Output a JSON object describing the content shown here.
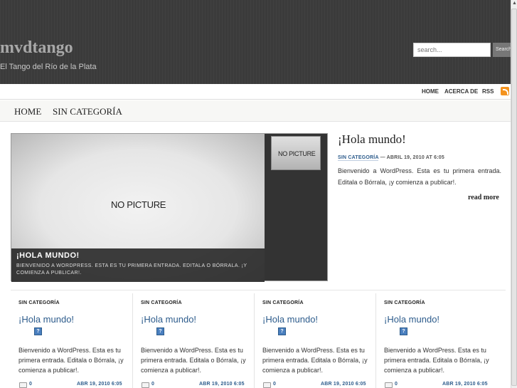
{
  "site": {
    "title": "mvdtango",
    "tagline": "El Tango del Río de la Plata"
  },
  "search": {
    "placeholder": "search...",
    "button_label": "Search"
  },
  "top_links": [
    "HOME",
    "ACERCA DE",
    "RSS"
  ],
  "category_nav": [
    "HOME",
    "SIN CATEGORÍA"
  ],
  "slider": {
    "image_text": "NO PICTURE",
    "caption_title": "¡HOLA MUNDO!",
    "caption_text": "BIENVENIDO A WORDPRESS. ESTA ES TU PRIMERA ENTRADA. EDITALA O BÓRRALA. ¡Y COMIENZA A PUBLICAR!.",
    "thumb_text": "NO PICTURE"
  },
  "featured": {
    "title": "¡Hola mundo!",
    "category": "SIN CATEGORÍA",
    "meta": " — ABRIL 19, 2010 AT 6:05",
    "excerpt": "Bienvenido a WordPress. Esta es tu primera entrada. Editala o Bórrala, ¡y comienza a publicar!.",
    "read_more": "read more"
  },
  "posts": [
    {
      "category": "SIN CATEGORÍA",
      "title": "¡Hola mundo!",
      "image_icon": "?",
      "excerpt": "Bienvenido a WordPress. Esta es tu primera entrada. Editala o Bórrala, ¡y comienza a publicar!.",
      "comments": "0",
      "date": "ABR 19, 2010 6:05"
    },
    {
      "category": "SIN CATEGORÍA",
      "title": "¡Hola mundo!",
      "image_icon": "?",
      "excerpt": "Bienvenido a WordPress. Esta es tu primera entrada. Editala o Bórrala, ¡y comienza a publicar!.",
      "comments": "0",
      "date": "ABR 19, 2010 6:05"
    },
    {
      "category": "SIN CATEGORÍA",
      "title": "¡Hola mundo!",
      "image_icon": "?",
      "excerpt": "Bienvenido a WordPress. Esta es tu primera entrada. Editala o Bórrala, ¡y comienza a publicar!.",
      "comments": "0",
      "date": "ABR 19, 2010 6:05"
    },
    {
      "category": "SIN CATEGORÍA",
      "title": "¡Hola mundo!",
      "image_icon": "?",
      "excerpt": "Bienvenido a WordPress. Esta es tu primera entrada. Editala o Bórrala, ¡y comienza a publicar!.",
      "comments": "0",
      "date": "ABR 19, 2010 6:05"
    }
  ],
  "scrollbar": {
    "up_glyph": "▲"
  },
  "colors": {
    "header_bg": "#3b3b3b",
    "link_blue": "#2d5c8c",
    "rss_orange": "#f4931e"
  }
}
